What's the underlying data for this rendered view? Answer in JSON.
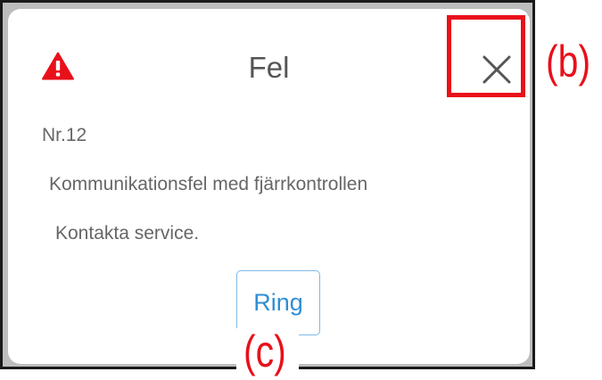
{
  "dialog": {
    "title": "Fel",
    "icon": "warning-triangle-icon",
    "icon_color": "#e8101a",
    "error_number": "Nr.12",
    "message_line_1": "Kommunikationsfel med fjärrkontrollen",
    "message_line_2": "Kontakta service.",
    "close_icon": "close-icon",
    "ring_button_label": "Ring",
    "accent_color": "#2e8fd6"
  },
  "annotations": {
    "close_label": "(b)",
    "ring_label": "(c)",
    "color": "#e8101a"
  }
}
